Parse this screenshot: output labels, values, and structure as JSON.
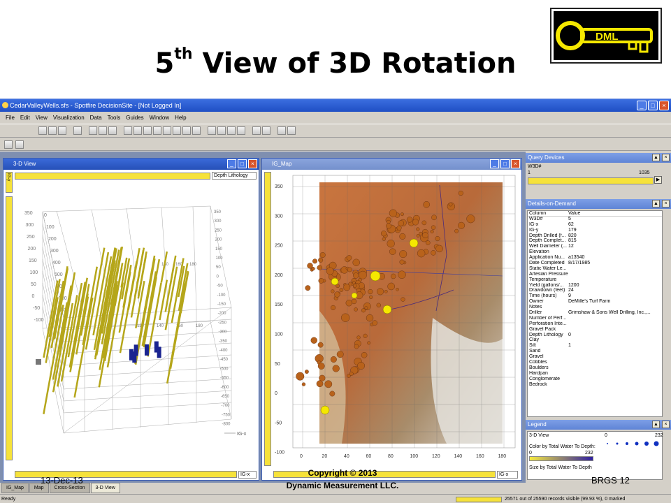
{
  "slide": {
    "title_main": "5",
    "title_sup": "th",
    "title_rest": " View of 3D Rotation",
    "logo_text": "DML",
    "date": "13-Dec-13",
    "copyright_line1": "Copyright © 2013",
    "copyright_line2": "Dynamic Measurement LLC.",
    "footer_right": "BRGS 12"
  },
  "window": {
    "title": "CedarValleyWells.sfs - Spotfire DecisionSite - [Not Logged In]",
    "menus": [
      "File",
      "Edit",
      "View",
      "Visualization",
      "Data",
      "Tools",
      "Guides",
      "Window",
      "Help"
    ]
  },
  "pane3d": {
    "title": "3-D View",
    "y_axis": "IG-y",
    "color_combo": "Depth Lithology",
    "x_axis_combo": "IG-x",
    "axis_label": "IG-x",
    "left_ticks": [
      "350",
      "300",
      "250",
      "200",
      "150",
      "100",
      "50",
      "0",
      "-50",
      "-100"
    ],
    "depth_ticks": [
      "0",
      "100",
      "200",
      "300",
      "400",
      "500",
      "600",
      "700",
      "800"
    ],
    "right_ticks": [
      "350",
      "300",
      "250",
      "200",
      "150",
      "100",
      "50",
      "0",
      "-50",
      "-100",
      "-150",
      "-200",
      "-250",
      "-300",
      "-350",
      "-400",
      "-450",
      "-500",
      "-550",
      "-600",
      "-650",
      "-700",
      "-750",
      "-800"
    ],
    "top_ticks": [
      "140",
      "160",
      "180"
    ],
    "mid_ticks": [
      "120",
      "140",
      "160",
      "180"
    ]
  },
  "paneMap": {
    "title": "IG_Map",
    "x_axis_combo": "IG-x",
    "y_ticks": [
      "350",
      "300",
      "250",
      "200",
      "150",
      "100",
      "50",
      "0",
      "-50",
      "-100"
    ],
    "x_ticks": [
      "0",
      "20",
      "40",
      "60",
      "80",
      "100",
      "120",
      "140",
      "160",
      "180"
    ]
  },
  "query": {
    "title": "Query Devices",
    "field": "W3D#",
    "min": "1",
    "max": "1035"
  },
  "dod": {
    "title": "Details-on-Demand",
    "col_header": "Column",
    "val_header": "Value",
    "rows": [
      [
        "W3D#",
        "5"
      ],
      [
        "IG-x",
        "62"
      ],
      [
        "IG-y",
        "179"
      ],
      [
        "Depth Drilled (f...",
        "820"
      ],
      [
        "Depth Complet...",
        "815"
      ],
      [
        "Well Diameter (...",
        "12"
      ],
      [
        "Elevation",
        ""
      ],
      [
        "Application Nu...",
        "a13540"
      ],
      [
        "Date Completed",
        "8/17/1985"
      ],
      [
        "Static Water Le...",
        ""
      ],
      [
        "Artesian Pressure",
        ""
      ],
      [
        "Temperature",
        ""
      ],
      [
        "Yield (gallons/...",
        "1200"
      ],
      [
        "Drawdown (feet)",
        "24"
      ],
      [
        "Time (hours)",
        "9"
      ],
      [
        "Owner",
        "DeMille's Turf Farm"
      ],
      [
        "Notes",
        ""
      ],
      [
        "Driller",
        "Grimshaw & Sons Well Drilling, Inc.,..."
      ],
      [
        "Number of Perf...",
        ""
      ],
      [
        "Perforation Inte...",
        ""
      ],
      [
        "Gravel Pack",
        ""
      ],
      [
        "Depth Lithology",
        "0"
      ],
      [
        "Clay",
        ""
      ],
      [
        "Silt",
        "1"
      ],
      [
        "Sand",
        ""
      ],
      [
        "Gravel",
        ""
      ],
      [
        "Cobbles",
        ""
      ],
      [
        "Boulders",
        ""
      ],
      [
        "Hardpan",
        ""
      ],
      [
        "Conglomerate",
        ""
      ],
      [
        "Bedrock",
        ""
      ]
    ]
  },
  "legend": {
    "title": "Legend",
    "view": "3-D View",
    "size_min": "0",
    "size_max": "232",
    "color_label": "Color by Total Water To Depth:",
    "color_min": "0",
    "color_max": "232",
    "size_label": "Size by Total Water To Depth"
  },
  "tabs": [
    "IG_Map",
    "Map",
    "Cross-Section",
    "3-D View"
  ],
  "status": {
    "left": "Ready",
    "right": "25571 out of 25590 records visible (99.93 %), 0 marked"
  },
  "colors": {
    "accent": "#f6e23a",
    "title_blue": "#2650b8",
    "wells": "#b5a61a",
    "points": "#b8621b"
  }
}
